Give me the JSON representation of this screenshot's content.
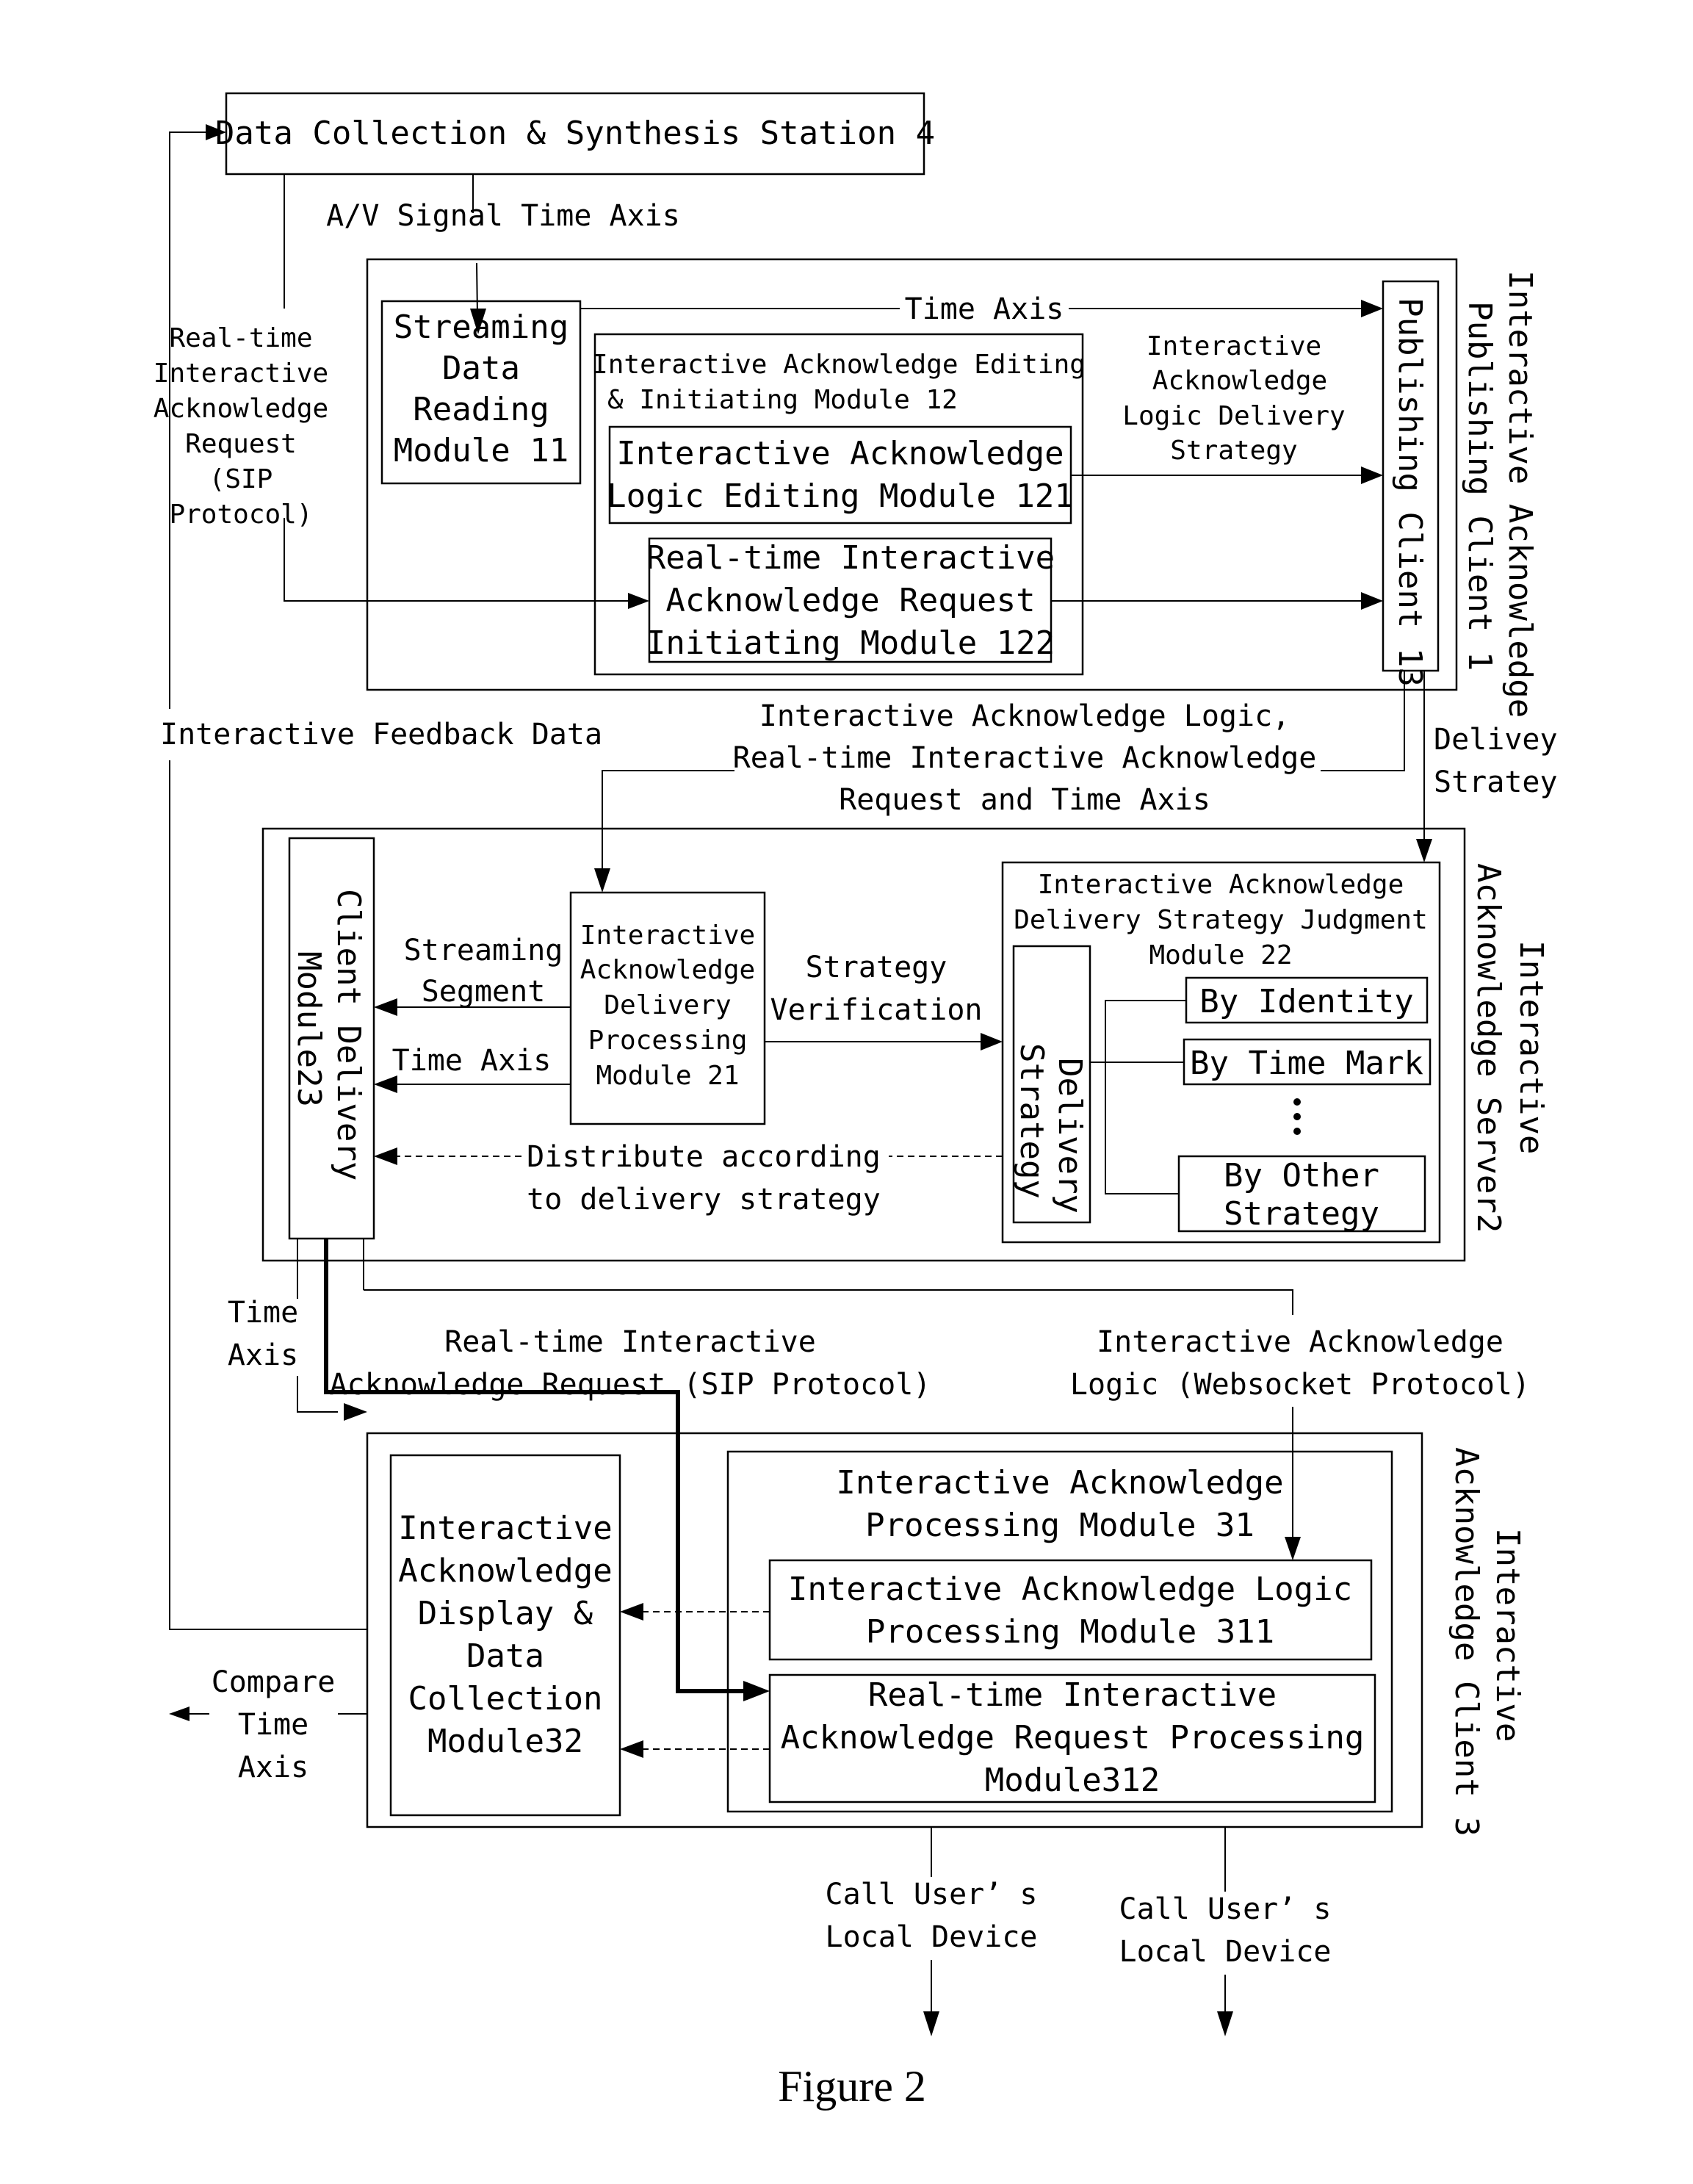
{
  "figure_caption": "Figure 2",
  "station": {
    "label": "Data Collection & Synthesis Station 4"
  },
  "publishing_client": {
    "title_lines": [
      "Interactive Acknowledge",
      "Publishing Client 1"
    ],
    "streaming_module": [
      "Streaming",
      "Data",
      "Reading",
      "Module 11"
    ],
    "editing_initiating_module": [
      "Interactive Acknowledge Editing",
      "& Initiating Module 12"
    ],
    "logic_editing_module": [
      "Interactive Acknowledge",
      "Logic Editing Module 121"
    ],
    "request_initiating_module": [
      "Real-time Interactive",
      "Acknowledge Request",
      "Initiating Module 122"
    ],
    "publishing_client_13": "Publishing Client 13"
  },
  "server": {
    "title_lines": [
      "Interactive",
      "Acknowledge Server2"
    ],
    "client_delivery_module": [
      "Client Delivery",
      "Module23"
    ],
    "delivery_processing_module": [
      "Interactive",
      "Acknowledge",
      "Delivery",
      "Processing",
      "Module 21"
    ],
    "judgment_module": [
      "Interactive Acknowledge",
      "Delivery Strategy Judgment",
      "Module 22"
    ],
    "delivery_strategy_box": [
      "Delivery",
      "Strategy"
    ],
    "strategies": [
      {
        "label_lines": [
          "By Identity"
        ]
      },
      {
        "label_lines": [
          "By Time Mark"
        ]
      },
      {
        "label_lines": [
          "By Other",
          "Strategy"
        ]
      }
    ],
    "ellipsis": "⋮"
  },
  "interactive_client": {
    "title_lines": [
      "Interactive",
      "Acknowledge Client 3"
    ],
    "display_module": [
      "Interactive",
      "Acknowledge",
      "Display &",
      "Data",
      "Collection",
      "Module32"
    ],
    "processing_module": [
      "Interactive Acknowledge",
      "Processing Module 31"
    ],
    "logic_processing_module": [
      "Interactive Acknowledge Logic",
      "Processing Module 311"
    ],
    "request_processing_module": [
      "Real-time Interactive",
      "Acknowledge Request Processing",
      "Module312"
    ]
  },
  "edge_labels": {
    "av_signal": "A/V Signal Time Axis",
    "time_axis_top": "Time Axis",
    "logic_delivery_strategy": [
      "Interactive",
      "Acknowledge",
      "Logic Delivery",
      "Strategy"
    ],
    "realtime_request_sip": [
      "Real-time",
      "Interactive",
      "Acknowledge",
      "Request",
      "(SIP",
      "Protocol)"
    ],
    "feedback_data": "Interactive Feedback Data",
    "logic_request_time": [
      "Interactive Acknowledge Logic,",
      "Real-time Interactive Acknowledge",
      "Request and Time Axis"
    ],
    "delivey_stratey": [
      "Delivey",
      "Stratey"
    ],
    "streaming_segment": [
      "Streaming",
      "Segment"
    ],
    "time_axis_mid": "Time Axis",
    "strategy_verification": [
      "Strategy",
      "Verification"
    ],
    "distribute": [
      "Distribute according",
      "to delivery strategy"
    ],
    "time_axis_low": [
      "Time",
      "Axis"
    ],
    "request_sip_low": [
      "Real-time Interactive",
      "Acknowledge Request (SIP Protocol)"
    ],
    "logic_websocket": [
      "Interactive Acknowledge",
      "Logic (Websocket Protocol)"
    ],
    "compare_time_axis": [
      "Compare",
      "Time",
      "Axis"
    ],
    "call_device_1": [
      "Call User’ s",
      "Local Device"
    ],
    "call_device_2": [
      "Call User’ s",
      "Local Device"
    ]
  }
}
